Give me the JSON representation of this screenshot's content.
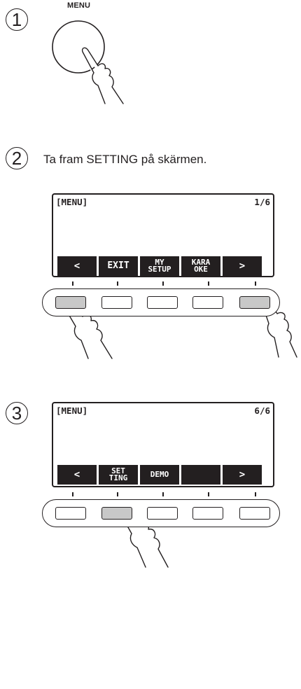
{
  "step1": {
    "number": "1",
    "button_label": "MENU"
  },
  "step2": {
    "number": "2",
    "instruction": "Ta fram SETTING på skärmen.",
    "display": {
      "title": "[MENU]",
      "page": "1/6"
    },
    "softkeys": [
      "<",
      "EXIT",
      "MY\nSETUP",
      "KARA\nOKE",
      ">"
    ],
    "pressed_buttons": [
      1,
      5
    ]
  },
  "step3": {
    "number": "3",
    "display": {
      "title": "[MENU]",
      "page": "6/6"
    },
    "softkeys": [
      "<",
      "SET\nTING",
      "DEMO",
      "",
      ">"
    ],
    "pressed_buttons": [
      2
    ]
  },
  "icons": [
    "pointing-hand-icon"
  ],
  "colors": {
    "line": "#231f20",
    "pressed": "#c8c8c8",
    "softkey_bg": "#231f20"
  }
}
